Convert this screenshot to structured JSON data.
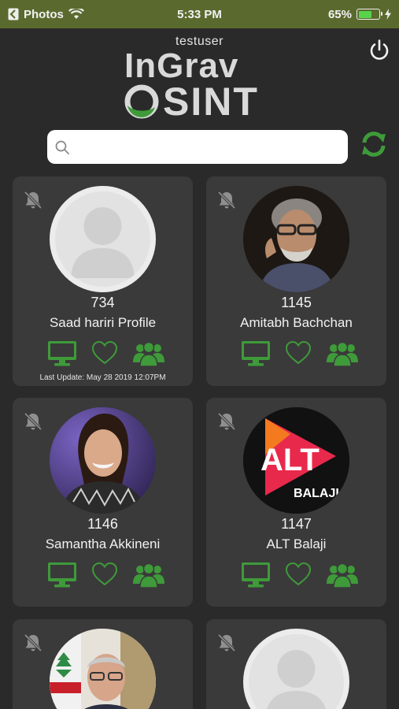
{
  "status_bar": {
    "back_app": "Photos",
    "time": "5:33 PM",
    "battery_percent": "65%",
    "battery_level": 0.65
  },
  "header": {
    "username": "testuser",
    "logo_top": "InGrav",
    "logo_bottom": "SINT"
  },
  "search": {
    "placeholder": "",
    "value": ""
  },
  "colors": {
    "accent_green": "#3f9a3a",
    "status_bar": "#5a6a2e",
    "card": "#3a3a3a",
    "background": "#2a2a2a"
  },
  "cards": [
    {
      "count": "734",
      "name": "Saad hariri Profile",
      "last_update": "Last Update: May 28 2019 12:07PM",
      "avatar": "placeholder-person"
    },
    {
      "count": "1145",
      "name": "Amitabh Bachchan",
      "last_update": "",
      "avatar": "photo-man-glasses-beard"
    },
    {
      "count": "1146",
      "name": "Samantha Akkineni",
      "last_update": "",
      "avatar": "photo-woman-smiling"
    },
    {
      "count": "1147",
      "name": "ALT Balaji",
      "last_update": "",
      "avatar": "alt-balaji-logo",
      "logo_text": "ALT",
      "logo_sub": "BALAJI"
    },
    {
      "count": "",
      "name": "",
      "last_update": "",
      "avatar": "photo-man-flag"
    },
    {
      "count": "",
      "name": "",
      "last_update": "",
      "avatar": "placeholder-person"
    }
  ],
  "icons": {
    "bell": "muted-bell-icon",
    "monitor": "monitor-icon",
    "heart": "heart-icon",
    "group": "group-icon",
    "power": "power-icon",
    "refresh": "refresh-icon",
    "search": "search-icon"
  }
}
